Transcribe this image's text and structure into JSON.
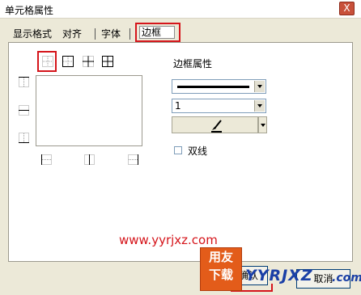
{
  "window": {
    "title": "单元格属性",
    "close_label": "X"
  },
  "tabs": [
    {
      "label": "显示格式"
    },
    {
      "label": "对齐"
    },
    {
      "label": "字体"
    },
    {
      "label": "边框",
      "active": true
    }
  ],
  "border_panel": {
    "heading": "边框属性",
    "line_width_value": "1",
    "double_line_label": "双线",
    "double_line_checked": false
  },
  "watermark": "www.yyrjxz.com",
  "buttons": {
    "ok_label": "确认",
    "cancel_label": "取消"
  },
  "logo": {
    "badge_top": "用友",
    "badge_bottom": "下载",
    "name": "YYRJXZ",
    "suffix": ".com"
  },
  "colors": {
    "highlight": "#d5151b",
    "dialog_bg": "#ece9d8",
    "accent": "#e35c1a",
    "logo_text": "#1a3fa6"
  }
}
